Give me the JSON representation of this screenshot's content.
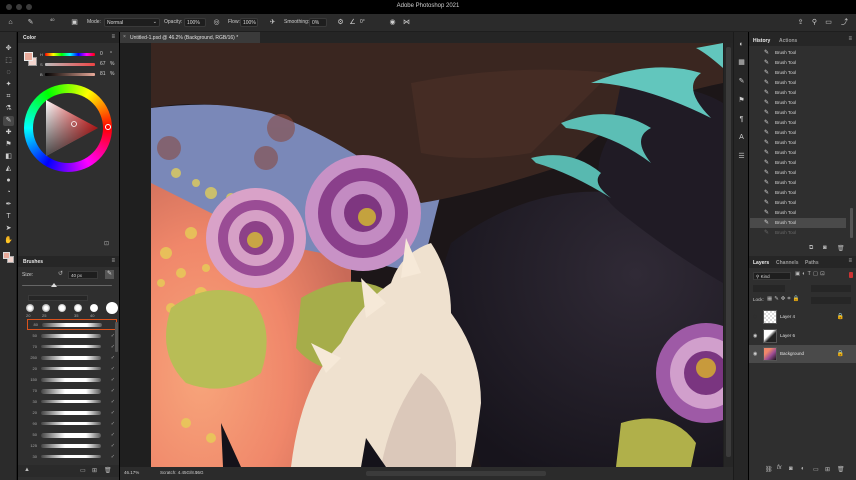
{
  "window": {
    "title": "Adobe Photoshop 2021"
  },
  "options_bar": {
    "mode_label": "Mode:",
    "mode_value": "Normal",
    "opacity_label": "Opacity:",
    "opacity_value": "100%",
    "flow_label": "Flow:",
    "flow_value": "100%",
    "smoothing_label": "Smoothing:",
    "smoothing_value": "0%",
    "angle_value": "0°",
    "brush_size": "40"
  },
  "document": {
    "tab_title": "Untitled-1.psd @ 46.2% (Background, RGB/16) *",
    "zoom_status": "46.17%",
    "status_info": "Scratch: 4.45G/8.55G"
  },
  "color_panel": {
    "title": "Color",
    "slider_values": [
      "0",
      "67",
      "81"
    ],
    "slider_units": [
      "°",
      "%",
      "%"
    ],
    "foreground_color": "#e8aa9a",
    "background_color": "#f3d6cf"
  },
  "brushes_panel": {
    "title": "Brushes",
    "size_label": "Size:",
    "size_value": "40 px",
    "preset_sizes": [
      "20",
      "25",
      "35",
      "40"
    ],
    "brush_sizes": [
      "80",
      "50",
      "70",
      "250",
      "20",
      "150",
      "70",
      "30",
      "20",
      "90",
      "50",
      "125",
      "30",
      "90"
    ]
  },
  "history_panel": {
    "tabs": [
      "History",
      "Actions"
    ],
    "items": [
      "Brush Tool",
      "Brush Tool",
      "Brush Tool",
      "Brush Tool",
      "Brush Tool",
      "Brush Tool",
      "Brush Tool",
      "Brush Tool",
      "Brush Tool",
      "Brush Tool",
      "Brush Tool",
      "Brush Tool",
      "Brush Tool",
      "Brush Tool",
      "Brush Tool",
      "Brush Tool",
      "Brush Tool",
      "Brush Tool",
      "Brush Tool"
    ]
  },
  "layers_panel": {
    "tabs": [
      "Layers",
      "Channels",
      "Paths"
    ],
    "filter_label": "Kind",
    "lock_label": "Lock:",
    "layers": [
      {
        "name": "Layer 4",
        "visible": false
      },
      {
        "name": "Layer 6",
        "visible": true
      },
      {
        "name": "Background",
        "visible": true,
        "selected": true
      }
    ]
  },
  "colors": {
    "panel_bg": "#2f2f2f",
    "accent_selected": "#4a4a4a",
    "brush_selection": "#d9531e"
  }
}
